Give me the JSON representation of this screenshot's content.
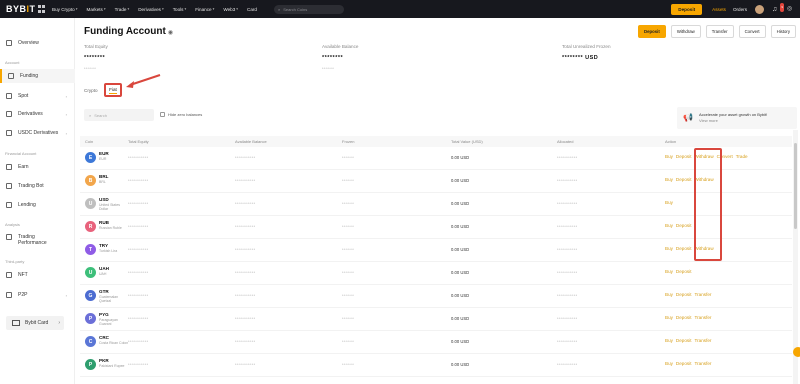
{
  "nav": {
    "logo_a": "BYB",
    "logo_b": "I",
    "logo_c": "T",
    "items": [
      "Buy Crypto",
      "Markets",
      "Trade",
      "Derivatives",
      "Tools",
      "Finance",
      "Web3",
      "Card"
    ],
    "search_placeholder": "Search Coins",
    "deposit": "Deposit",
    "assets": "Assets",
    "orders": "Orders",
    "bell_badge": "9"
  },
  "sidebar": {
    "overview": "Overview",
    "section_account": "Account",
    "funding": "Funding",
    "spot": "Spot",
    "derivatives": "Derivatives",
    "usdc": "USDC Derivatives",
    "section_earn": "Financial Account",
    "earn": "Earn",
    "trading_bot": "Trading Bot",
    "lending": "Lending",
    "section_analysis": "Analysis",
    "trading_perf": "Trading Performance",
    "section_tools": "Third-party",
    "nft": "NFT",
    "p2p": "P2P",
    "bottom": "Bybit Card"
  },
  "main": {
    "title": "Funding Account",
    "actions": [
      "Deposit",
      "Withdraw",
      "Transfer",
      "Convert",
      "History"
    ],
    "balances": [
      {
        "label": "Total Equity",
        "value": "********",
        "sub": "******"
      },
      {
        "label": "Available Balance",
        "value": "********",
        "sub": "******"
      },
      {
        "label": "Total Unrealized Frozen",
        "value": "******** USD",
        "sub": ""
      }
    ],
    "crypto_label": "Crypto",
    "fiat_label": "Fiat",
    "search_placeholder": "Search",
    "hide_zero": "Hide zero balances",
    "promo_text": "Accelerate your asset growth on Bybit!",
    "promo_more": "View more"
  },
  "table": {
    "headers": [
      "Coin",
      "Total Equity",
      "Available Balance",
      "Frozen",
      "Total Value (USD)",
      "Allocated",
      "Action"
    ],
    "rows": [
      {
        "sym": "EUR",
        "name": "EUR",
        "color": "#3d78d8",
        "usd": "0.00 USD",
        "actions": [
          "Buy",
          "Deposit",
          "Withdraw",
          "Convert",
          "Trade"
        ]
      },
      {
        "sym": "BRL",
        "name": "BRL",
        "color": "#f2a64b",
        "usd": "0.00 USD",
        "actions": [
          "Buy",
          "Deposit",
          "Withdraw"
        ]
      },
      {
        "sym": "USD",
        "name": "United States Dollar",
        "color": "#bfbfbf",
        "usd": "0.00 USD",
        "actions": [
          "Buy"
        ]
      },
      {
        "sym": "RUB",
        "name": "Russian Ruble",
        "color": "#e8627c",
        "usd": "0.00 USD",
        "actions": [
          "Buy",
          "Deposit"
        ]
      },
      {
        "sym": "TRY",
        "name": "Turkish Lira",
        "color": "#8f5ce6",
        "usd": "0.00 USD",
        "actions": [
          "Buy",
          "Deposit",
          "Withdraw"
        ]
      },
      {
        "sym": "UAH",
        "name": "UAH",
        "color": "#3dbf7a",
        "usd": "0.00 USD",
        "actions": [
          "Buy",
          "Deposit"
        ]
      },
      {
        "sym": "GTR",
        "name": "Guatemalan Quetzal",
        "color": "#4c6cd1",
        "usd": "0.00 USD",
        "actions": [
          "Buy",
          "Deposit",
          "Transfer"
        ]
      },
      {
        "sym": "PYG",
        "name": "Paraguayan Guarani",
        "color": "#6b6fd8",
        "usd": "0.00 USD",
        "actions": [
          "Buy",
          "Deposit",
          "Transfer"
        ]
      },
      {
        "sym": "CRC",
        "name": "Costa Rican Colon",
        "color": "#5a76d6",
        "usd": "0.00 USD",
        "actions": [
          "Buy",
          "Deposit",
          "Transfer"
        ]
      },
      {
        "sym": "PKR",
        "name": "Pakistani Rupee",
        "color": "#2e9e6e",
        "usd": "0.00 USD",
        "actions": [
          "Buy",
          "Deposit",
          "Transfer"
        ]
      }
    ]
  },
  "colors": {
    "accent": "#f7a600",
    "annotation_red": "#d9473d",
    "nav_bg": "#17181e"
  }
}
